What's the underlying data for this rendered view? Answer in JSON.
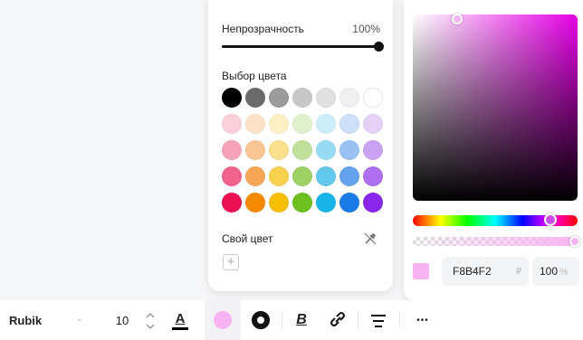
{
  "opacity": {
    "label": "Непрозрачность",
    "value": "100%",
    "level": 1.0
  },
  "palette": {
    "title": "Выбор цвета",
    "rows": [
      [
        "#000000",
        "#6b6b6b",
        "#9b9b9b",
        "#c8c8c8",
        "#e0e0e0",
        "#f0f0f0",
        "#ffffff"
      ],
      [
        "#fbd0da",
        "#fde2c9",
        "#fdf0c7",
        "#dff0cc",
        "#cceefa",
        "#cde0f9",
        "#e6d2f9"
      ],
      [
        "#f6a2b8",
        "#f9c592",
        "#fae08c",
        "#bfe09a",
        "#98dcf3",
        "#9ac1f3",
        "#cba3f3"
      ],
      [
        "#f2638b",
        "#f7a657",
        "#f8d14f",
        "#9dd163",
        "#62c8ec",
        "#64a2ee",
        "#ae6ff0"
      ],
      [
        "#ea1052",
        "#f58a00",
        "#f6bf00",
        "#6cbf1f",
        "#18b6e8",
        "#1a7ae6",
        "#8a26ec"
      ]
    ]
  },
  "custom": {
    "label": "Свой цвет",
    "add_symbol": "+"
  },
  "picker": {
    "hex": "F8B4F2",
    "hash": "#",
    "alpha": "100",
    "alpha_unit": "%",
    "color": "#f8b4f2"
  },
  "toolbar": {
    "font_name": "Rubik",
    "font_size": "10",
    "text_color_glyph": "A",
    "bold_glyph": "B",
    "more_glyph": "•••"
  },
  "icons": {
    "eyedropper": "eyedropper-icon",
    "dropdown": "chevron-down-icon",
    "stepper": "stepper-icon",
    "fill": "fill-color-icon",
    "stroke": "stroke-icon",
    "bold": "bold-icon",
    "link": "link-icon",
    "align": "align-icon",
    "more": "more-icon"
  }
}
